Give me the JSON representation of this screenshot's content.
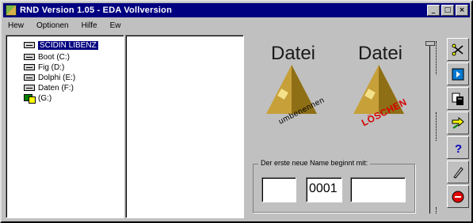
{
  "window": {
    "title": "RND Version 1.05 - EDA Vollversion",
    "minimize_glyph": "_",
    "maximize_glyph": "□",
    "close_glyph": "×"
  },
  "menu": {
    "items": [
      "Hew",
      "Optionen",
      "Hilfe",
      "Ew"
    ]
  },
  "drives": {
    "items": [
      {
        "label": "SCIDIN LIBENZ",
        "icon": "drive-icon",
        "selected": true
      },
      {
        "label": "Boot (C:)",
        "icon": "drive-icon"
      },
      {
        "label": "Fig (D:)",
        "icon": "drive-icon"
      },
      {
        "label": "Dolphi (E:)",
        "icon": "drive-icon"
      },
      {
        "label": "Daten (F:)",
        "icon": "drive-icon"
      },
      {
        "label": "(G:)",
        "icon": "network-icon"
      }
    ]
  },
  "actions": {
    "rename": {
      "title": "Datei",
      "subtitle": "umbenennen"
    },
    "delete": {
      "title": "Datei",
      "subtitle": "LÖSCHEN"
    }
  },
  "counter": {
    "legend": "Der erste neue Name beginnt mit:",
    "fields": [
      "",
      "0001",
      ""
    ]
  },
  "toolbar": {
    "buttons": [
      "cut-icon",
      "play-icon",
      "copy-icon",
      "transfer-icon",
      "help-icon",
      "edit-icon",
      "exit-icon"
    ]
  },
  "colors": {
    "titlebar": "#000080",
    "face": "#c0c0c0",
    "accent_red": "#d60000",
    "pyramid_gold": "#c7a03a"
  }
}
